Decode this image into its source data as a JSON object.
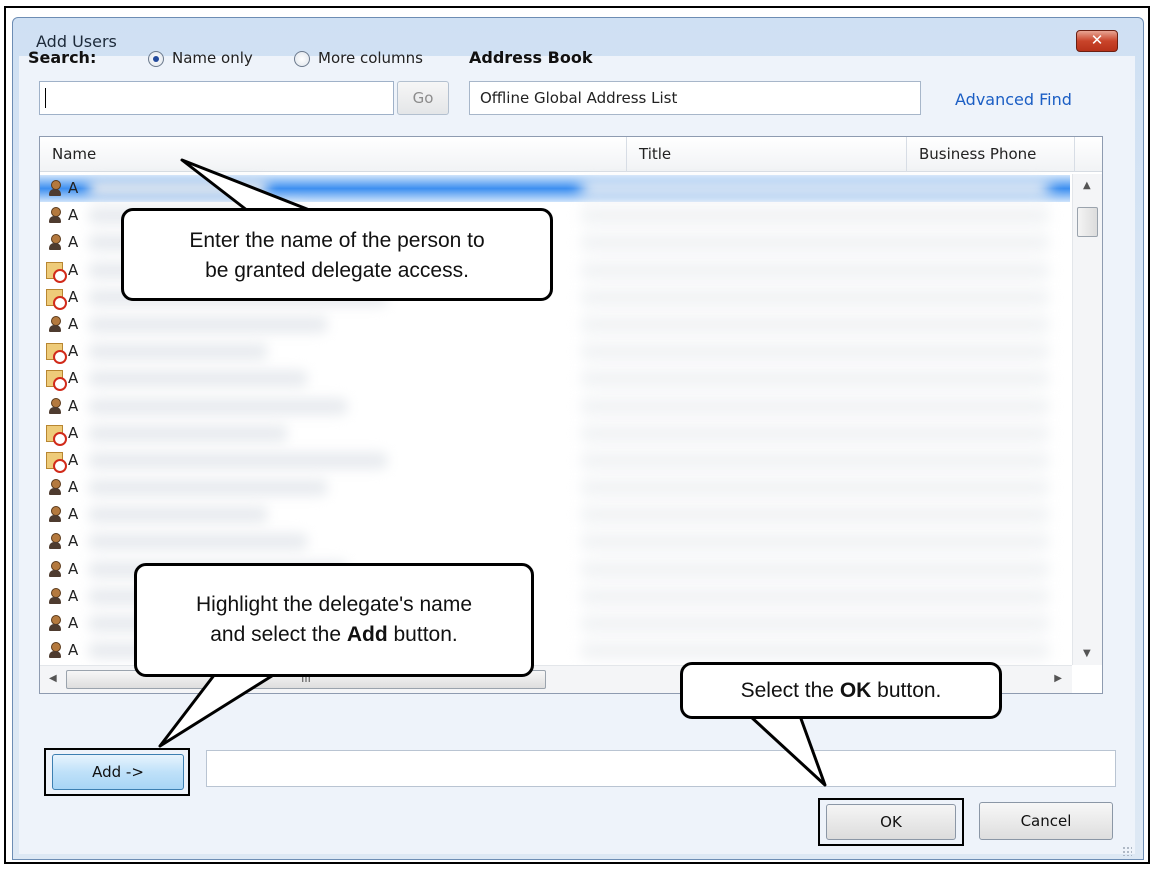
{
  "window": {
    "title": "Add Users",
    "close_label": "✕"
  },
  "search": {
    "label": "Search:",
    "option_name_only": "Name only",
    "option_more_columns": "More columns",
    "go_label": "Go",
    "value": ""
  },
  "address_book": {
    "label": "Address Book",
    "value": "Offline Global Address List",
    "advanced_find": "Advanced Find"
  },
  "columns": {
    "name": "Name",
    "title": "Title",
    "business_phone": "Business Phone"
  },
  "rows": [
    {
      "type": "person",
      "name": "A",
      "selected": true
    },
    {
      "type": "person",
      "name": "A"
    },
    {
      "type": "person",
      "name": "A"
    },
    {
      "type": "restricted",
      "name": "A"
    },
    {
      "type": "restricted",
      "name": "A"
    },
    {
      "type": "person",
      "name": "A"
    },
    {
      "type": "restricted",
      "name": "A"
    },
    {
      "type": "restricted",
      "name": "A"
    },
    {
      "type": "person",
      "name": "A"
    },
    {
      "type": "restricted",
      "name": "A"
    },
    {
      "type": "restricted",
      "name": "A"
    },
    {
      "type": "person",
      "name": "A"
    },
    {
      "type": "person",
      "name": "A"
    },
    {
      "type": "person",
      "name": "A"
    },
    {
      "type": "person",
      "name": "A"
    },
    {
      "type": "person",
      "name": "A"
    },
    {
      "type": "person",
      "name": "A"
    },
    {
      "type": "person",
      "name": "A"
    }
  ],
  "scroll": {
    "h_thumb_label": "III"
  },
  "buttons": {
    "add": "Add ->",
    "ok": "OK",
    "cancel": "Cancel"
  },
  "callouts": {
    "search_tip": {
      "line1": "Enter the name of the person to",
      "line2": "be granted delegate access."
    },
    "add_tip": {
      "line1": "Highlight the delegate's name",
      "line2_pre": "and select the ",
      "line2_bold": "Add",
      "line2_post": " button."
    },
    "ok_tip": {
      "pre": "Select the ",
      "bold": "OK",
      "post": " button."
    }
  }
}
